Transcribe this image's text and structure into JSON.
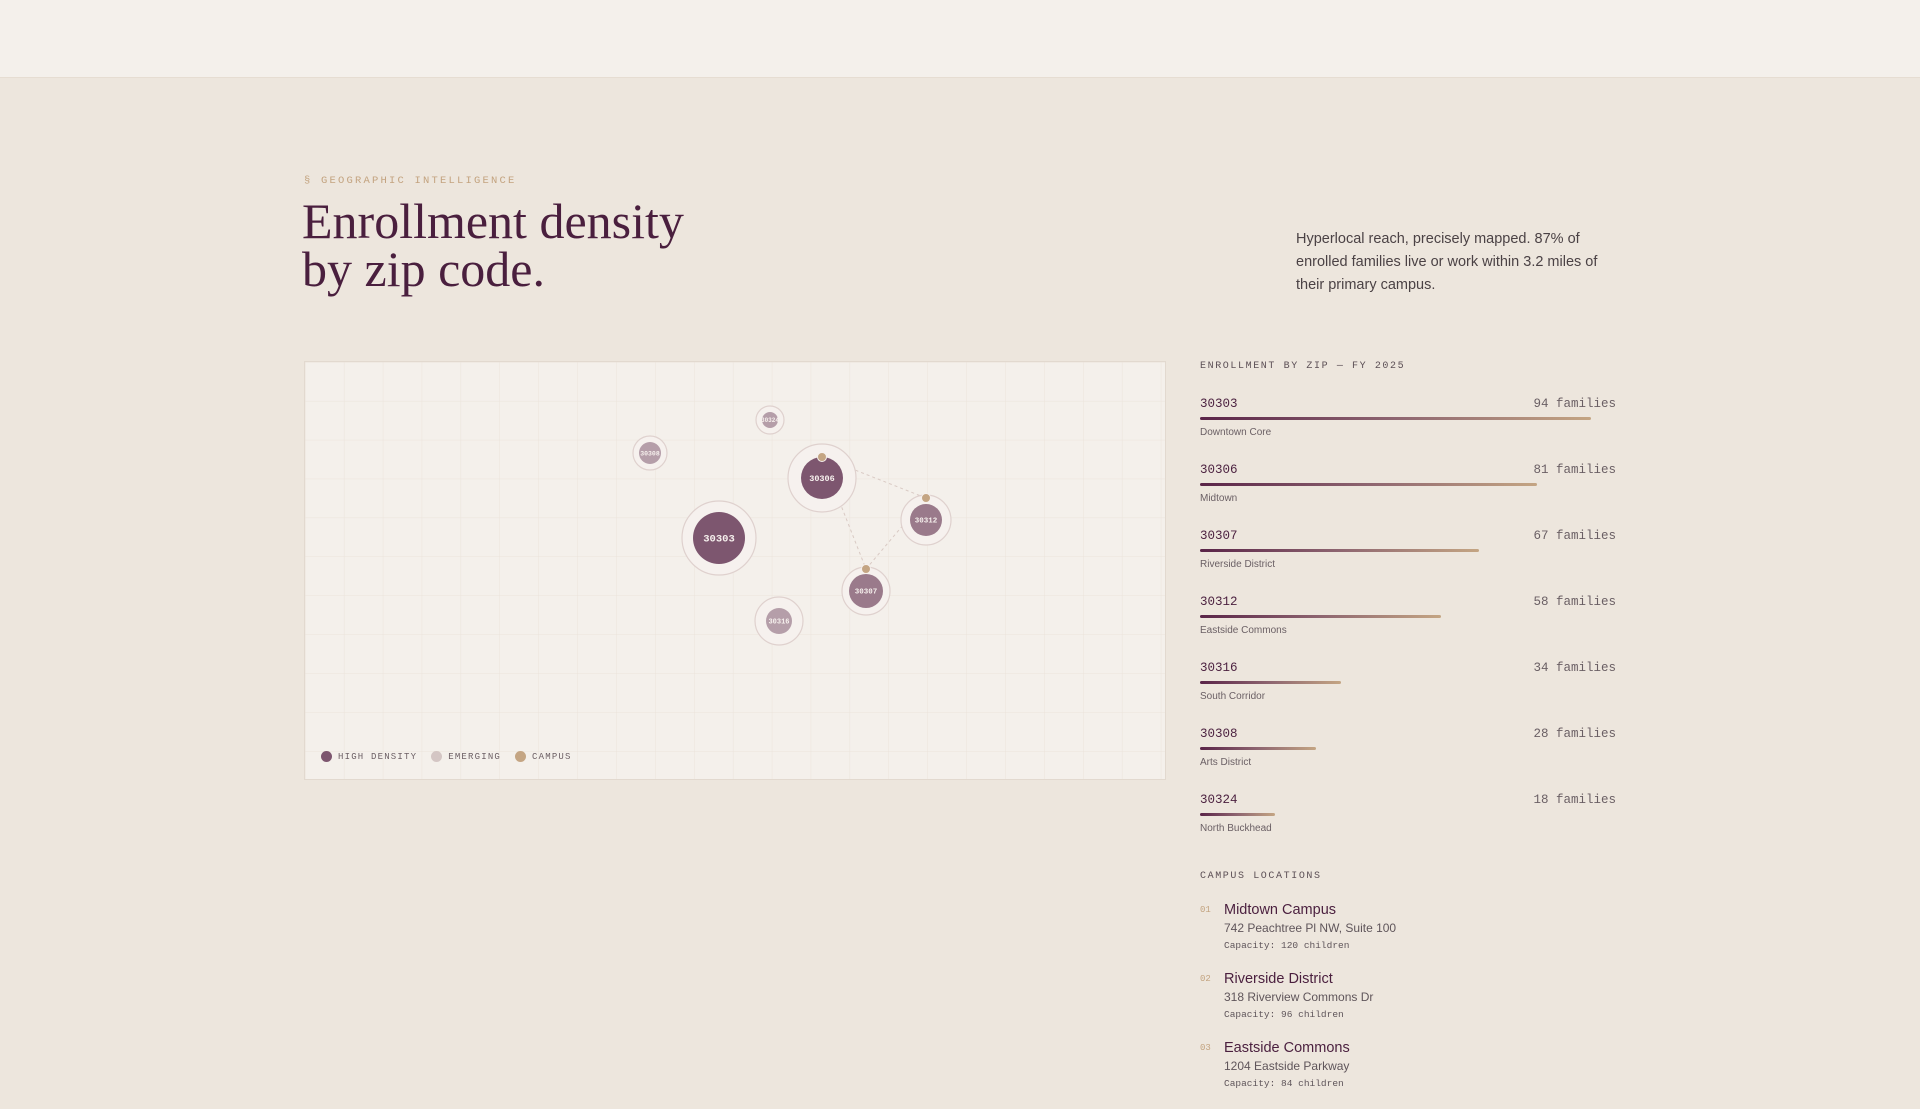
{
  "header": {
    "eyebrow": "§ GEOGRAPHIC INTELLIGENCE",
    "title_line1": "Enrollment density",
    "title_line2": "by zip code.",
    "intro": "Hyperlocal reach, precisely mapped. 87% of enrolled families live or work within 3.2 miles of their primary campus."
  },
  "map": {
    "nodes": [
      {
        "zip": "30303",
        "level": "high"
      },
      {
        "zip": "30306",
        "level": "high"
      },
      {
        "zip": "30312",
        "level": "mid"
      },
      {
        "zip": "30307",
        "level": "mid"
      },
      {
        "zip": "30316",
        "level": "emerging"
      },
      {
        "zip": "30308",
        "level": "emerging"
      },
      {
        "zip": "30324",
        "level": "emerging"
      }
    ],
    "legend": {
      "high": "HIGH DENSITY",
      "emerging": "EMERGING",
      "campus": "CAMPUS"
    },
    "colors": {
      "high": "#7d566f",
      "mid": "#9a7a8b",
      "emerging": "#b59ea9",
      "legend_emerging": "#d4c6c4",
      "campus": "#c4a583"
    }
  },
  "enrollment": {
    "label": "ENROLLMENT BY ZIP — FY 2025",
    "max_families": 100,
    "rows": [
      {
        "zip": "30303",
        "count_text": "94 families",
        "families": 94,
        "area": "Downtown Core"
      },
      {
        "zip": "30306",
        "count_text": "81 families",
        "families": 81,
        "area": "Midtown"
      },
      {
        "zip": "30307",
        "count_text": "67 families",
        "families": 67,
        "area": "Riverside District"
      },
      {
        "zip": "30312",
        "count_text": "58 families",
        "families": 58,
        "area": "Eastside Commons"
      },
      {
        "zip": "30316",
        "count_text": "34 families",
        "families": 34,
        "area": "South Corridor"
      },
      {
        "zip": "30308",
        "count_text": "28 families",
        "families": 28,
        "area": "Arts District"
      },
      {
        "zip": "30324",
        "count_text": "18 families",
        "families": 18,
        "area": "North Buckhead"
      }
    ]
  },
  "campuses": {
    "label": "CAMPUS LOCATIONS",
    "items": [
      {
        "num": "01",
        "name": "Midtown Campus",
        "address": "742 Peachtree Pl NW, Suite 100",
        "capacity": "Capacity: 120 children"
      },
      {
        "num": "02",
        "name": "Riverside District",
        "address": "318 Riverview Commons Dr",
        "capacity": "Capacity: 96 children"
      },
      {
        "num": "03",
        "name": "Eastside Commons",
        "address": "1204 Eastside Parkway",
        "capacity": "Capacity: 84 children"
      }
    ]
  }
}
